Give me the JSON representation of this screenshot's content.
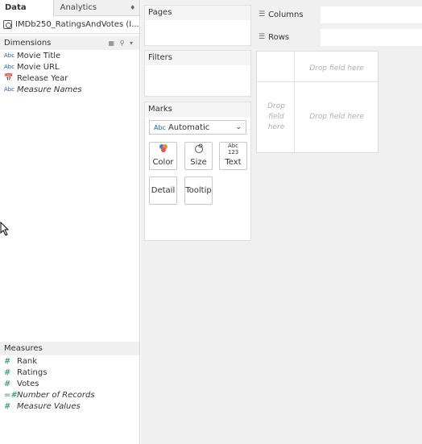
{
  "tabs": {
    "data": "Data",
    "analytics": "Analytics"
  },
  "datasource": {
    "name": "IMDb250_RatingsAndVotes (I..."
  },
  "dimensions": {
    "header": "Dimensions",
    "items": [
      {
        "icon": "Abc",
        "label": "Movie Title"
      },
      {
        "icon": "Abc",
        "label": "Movie URL"
      },
      {
        "icon": "calendar",
        "label": "Release Year"
      },
      {
        "icon": "Abc",
        "label": "Measure Names"
      }
    ]
  },
  "measures": {
    "header": "Measures",
    "items": [
      {
        "icon": "#",
        "label": "Rank"
      },
      {
        "icon": "#",
        "label": "Ratings"
      },
      {
        "icon": "#",
        "label": "Votes"
      },
      {
        "icon": "=#",
        "label": "Number of Records"
      },
      {
        "icon": "#",
        "label": "Measure Values"
      }
    ]
  },
  "cards": {
    "pages": "Pages",
    "filters": "Filters",
    "marks": "Marks",
    "marks_type": "Automatic",
    "marks_type_icon": "Abc",
    "buttons": {
      "color": "Color",
      "size": "Size",
      "text": "Text",
      "text_icon": "Abc 123",
      "detail": "Detail",
      "tooltip": "Tooltip"
    }
  },
  "shelves": {
    "columns": "Columns",
    "rows": "Rows"
  },
  "viz": {
    "drop_top": "Drop field here",
    "drop_left": "Drop field here",
    "drop_main": "Drop field here"
  }
}
